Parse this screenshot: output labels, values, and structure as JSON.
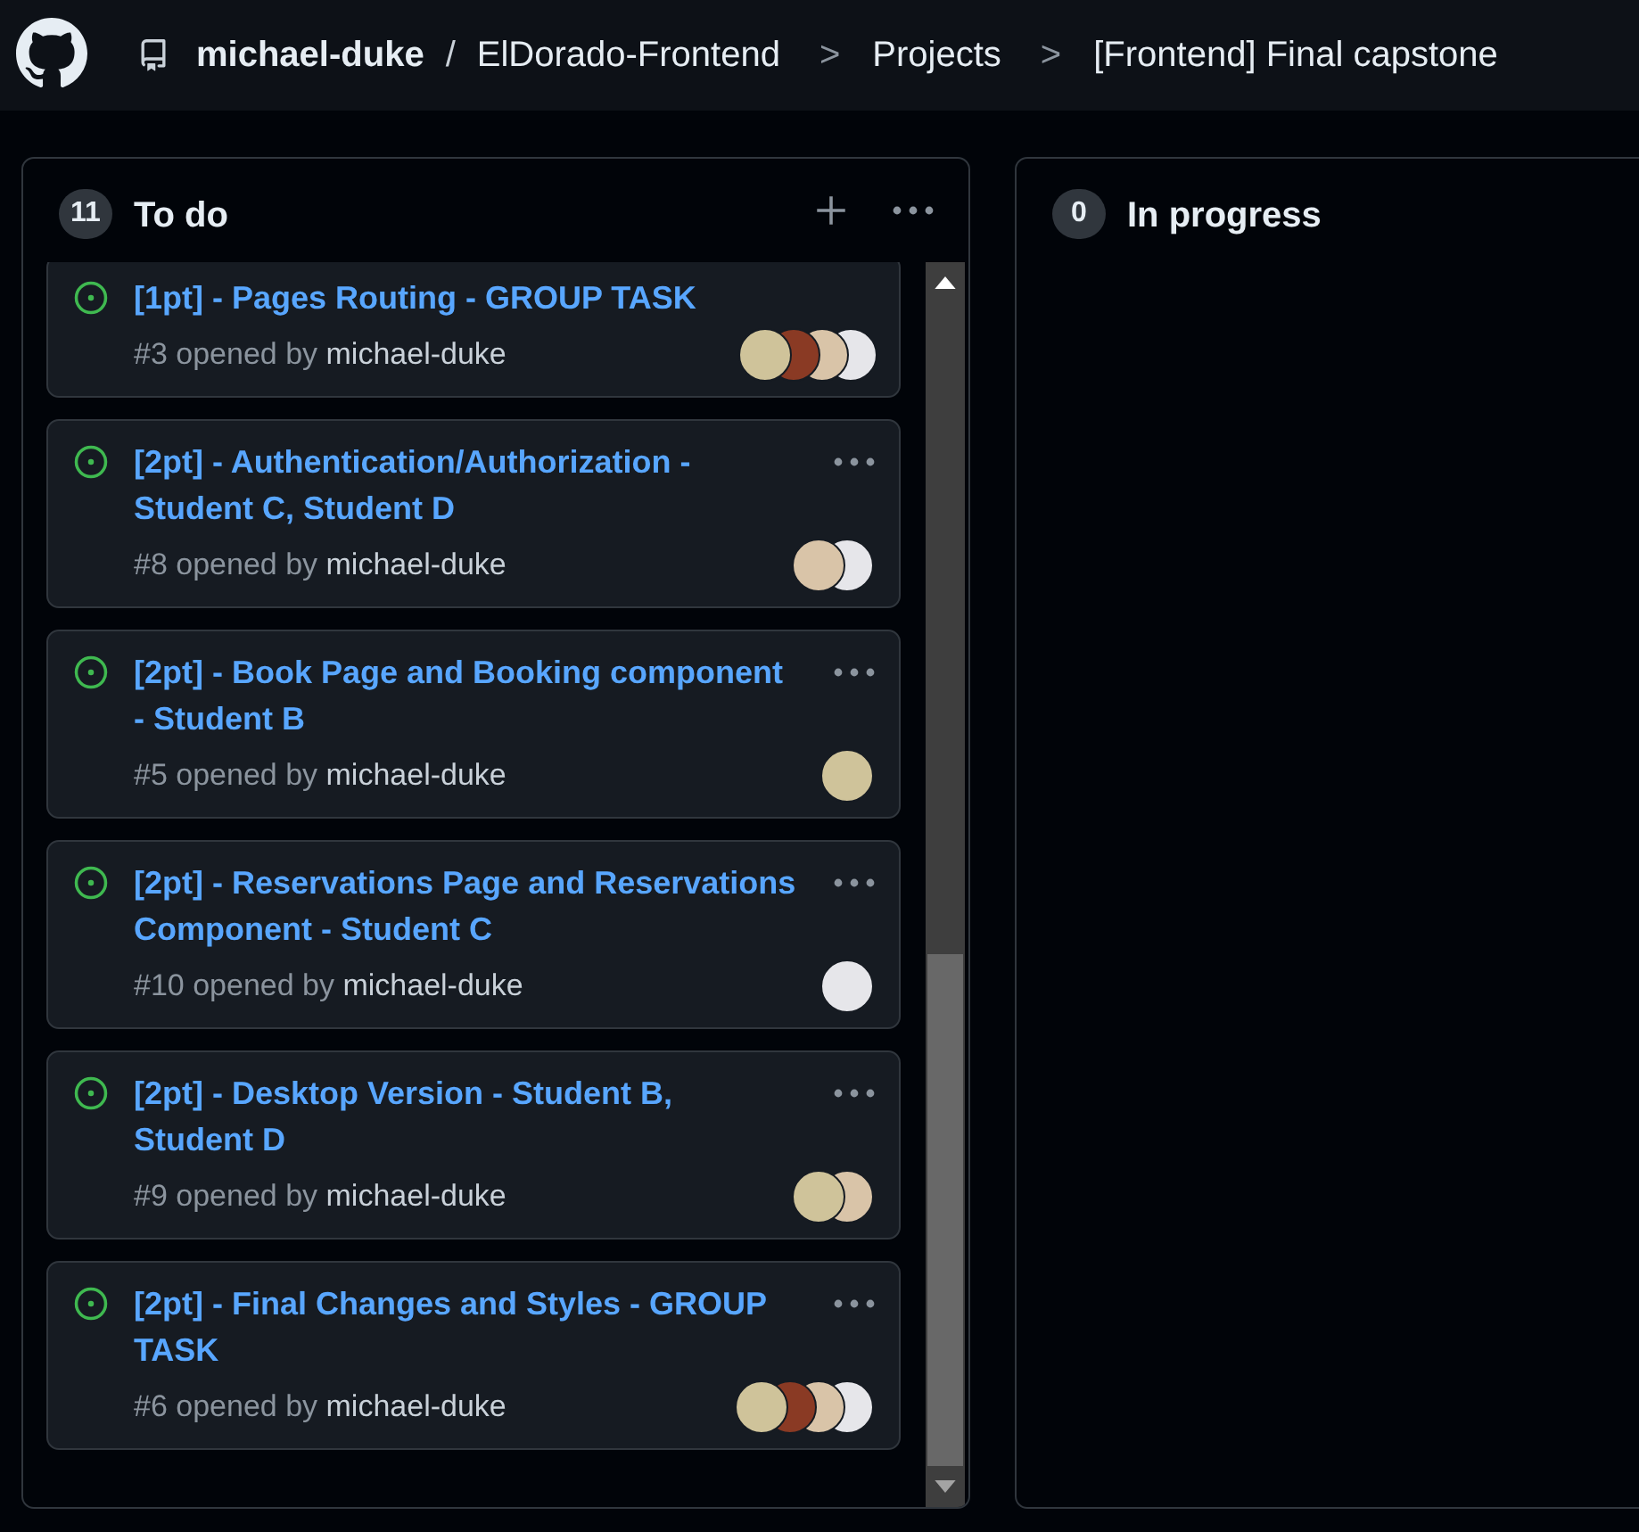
{
  "breadcrumb": {
    "owner": "michael-duke",
    "separator": "/",
    "repo": "ElDorado-Frontend",
    "chevrons": [
      ">",
      ">"
    ],
    "section": "Projects",
    "project": "[Frontend] Final capstone"
  },
  "columns": [
    {
      "count": "11",
      "title": "To do",
      "cards": [
        {
          "title": "[1pt] - Pages Routing - GROUP TASK",
          "number": "#3",
          "opened_by": "opened by",
          "author": "michael-duke",
          "has_menu": false,
          "assignees": [
            {
              "color": "#cfc39a"
            },
            {
              "color": "#8a3a24"
            },
            {
              "color": "#d9c4a8"
            },
            {
              "color": "#e6e6ea"
            }
          ]
        },
        {
          "title": "[2pt] - Authentication/Authorization - Student C, Student D",
          "number": "#8",
          "opened_by": "opened by",
          "author": "michael-duke",
          "has_menu": true,
          "assignees": [
            {
              "color": "#d9c4a8"
            },
            {
              "color": "#e6e6ea"
            }
          ]
        },
        {
          "title": "[2pt] - Book Page and Booking component - Student B",
          "number": "#5",
          "opened_by": "opened by",
          "author": "michael-duke",
          "has_menu": true,
          "assignees": [
            {
              "color": "#cfc39a"
            }
          ]
        },
        {
          "title": "[2pt] - Reservations Page and Reservations Component - Student C",
          "number": "#10",
          "opened_by": "opened by",
          "author": "michael-duke",
          "has_menu": true,
          "assignees": [
            {
              "color": "#e6e6ea"
            }
          ]
        },
        {
          "title": "[2pt] - Desktop Version - Student B, Student D",
          "number": "#9",
          "opened_by": "opened by",
          "author": "michael-duke",
          "has_menu": true,
          "assignees": [
            {
              "color": "#cfc39a"
            },
            {
              "color": "#d9c4a8"
            }
          ]
        },
        {
          "title": "[2pt] - Final Changes and Styles - GROUP TASK",
          "number": "#6",
          "opened_by": "opened by",
          "author": "michael-duke",
          "has_menu": true,
          "assignees": [
            {
              "color": "#cfc39a"
            },
            {
              "color": "#8a3a24"
            },
            {
              "color": "#d9c4a8"
            },
            {
              "color": "#e6e6ea"
            }
          ]
        }
      ],
      "has_actions": true,
      "scrollbar": true
    },
    {
      "count": "0",
      "title": "In progress",
      "has_actions": false
    }
  ]
}
